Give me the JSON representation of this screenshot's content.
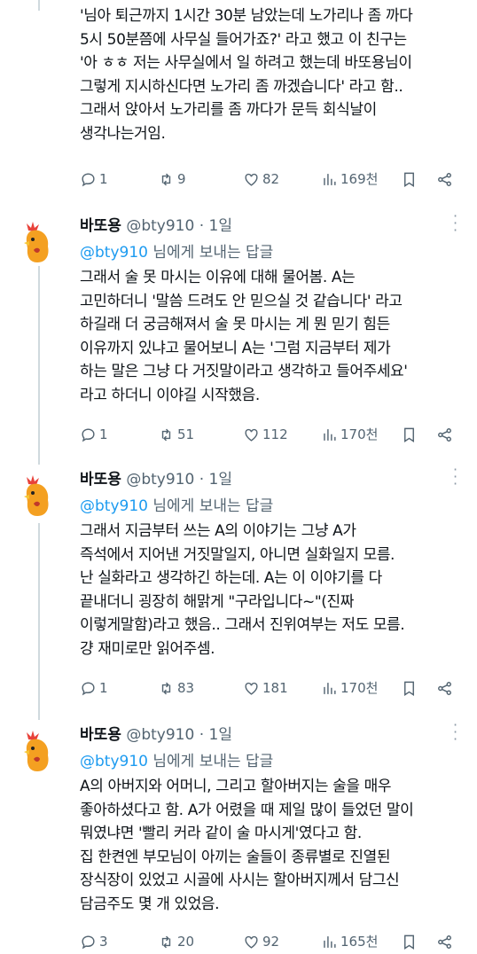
{
  "tweets": [
    {
      "body": "'님아 퇴근까지 1시간 30분 남았는데 노가리나 좀 까다\n5시 50분쯤에 사무실 들어가죠?' 라고 했고 이 친구는\n'아 ㅎㅎ 저는 사무실에서 일 하려고 했는데 바또용님이\n그렇게 지시하신다면 노가리 좀 까겠습니다' 라고 함..\n그래서 앉아서 노가리를 좀 까다가 문득 회식날이\n생각나는거임.",
      "stats": {
        "replies": "1",
        "retweets": "9",
        "likes": "82",
        "views": "169천"
      }
    },
    {
      "name": "바또용",
      "handle": "@bty910",
      "time": "· 1일",
      "reply_prefix": "@bty910",
      "reply_suffix": " 님에게 보내는 답글",
      "body": "그래서 술 못 마시는 이유에 대해 물어봄. A는\n고민하더니 '말씀 드려도 안 믿으실 것 같습니다' 라고\n하길래 더 궁금해져서 술 못 마시는 게 뭔 믿기 힘든\n이유까지 있냐고 물어보니 A는 '그럼 지금부터 제가\n하는 말은 그냥 다 거짓말이라고 생각하고 들어주세요'\n라고 하더니 이야길 시작했음.",
      "stats": {
        "replies": "1",
        "retweets": "51",
        "likes": "112",
        "views": "170천"
      }
    },
    {
      "name": "바또용",
      "handle": "@bty910",
      "time": "· 1일",
      "reply_prefix": "@bty910",
      "reply_suffix": " 님에게 보내는 답글",
      "body": "그래서 지금부터 쓰는 A의 이야기는 그냥 A가\n즉석에서 지어낸 거짓말일지, 아니면 실화일지 모름.\n난 실화라고 생각하긴 하는데. A는 이 이야기를 다\n끝내더니 굉장히 해맑게 \"구라입니다~\"(진짜\n이렇게말함)라고 했음.. 그래서 진위여부는 저도 모름.\n걍 재미로만 읽어주셈.",
      "stats": {
        "replies": "1",
        "retweets": "83",
        "likes": "181",
        "views": "170천"
      }
    },
    {
      "name": "바또용",
      "handle": "@bty910",
      "time": "· 1일",
      "reply_prefix": "@bty910",
      "reply_suffix": " 님에게 보내는 답글",
      "body": "A의 아버지와 어머니, 그리고 할아버지는 술을 매우\n좋아하셨다고 함. A가 어렸을 때 제일 많이 들었던 말이\n뭐였냐면 '빨리 커라 같이 술 마시게'였다고 함.\n집 한켠엔 부모님이 아끼는 술들이 종류별로 진열된\n장식장이 있었고  시골에 사시는 할아버지께서 담그신\n담금주도 몇 개 있었음.",
      "stats": {
        "replies": "3",
        "retweets": "20",
        "likes": "92",
        "views": "165천"
      }
    }
  ],
  "icons": {
    "reply": "speech-bubble-icon",
    "retweet": "retweet-icon",
    "like": "heart-icon",
    "views": "bar-chart-icon",
    "bookmark": "bookmark-icon",
    "share": "share-icon",
    "more": "vertical-dots-icon"
  },
  "colors": {
    "accent": "#1d9bf0",
    "muted": "#536471",
    "text": "#0f1419"
  }
}
